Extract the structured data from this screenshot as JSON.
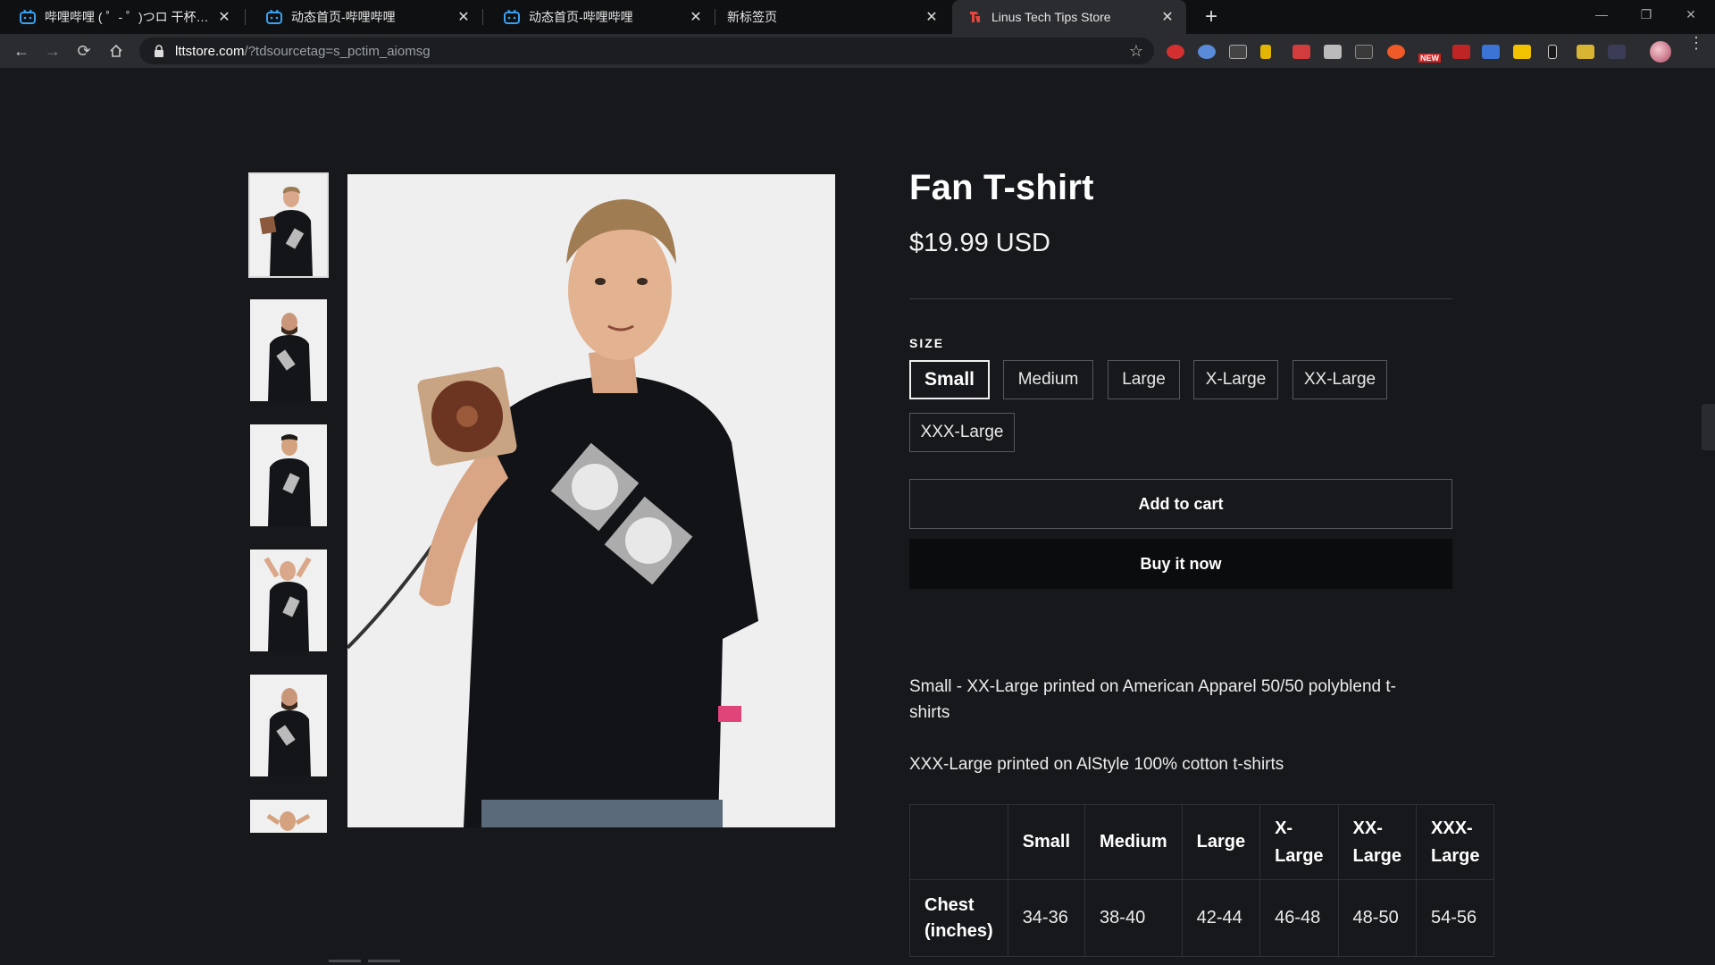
{
  "browser": {
    "tabs": [
      {
        "title": "哔哩哔哩 ( ゜- ゜)つロ 干杯~-bilibili",
        "icon": "bilibili-icon"
      },
      {
        "title": "动态首页-哔哩哔哩",
        "icon": "bilibili-icon"
      },
      {
        "title": "动态首页-哔哩哔哩",
        "icon": "bilibili-icon"
      },
      {
        "title": "新标签页",
        "icon": ""
      },
      {
        "title": "Linus Tech Tips Store",
        "icon": "ltt-icon"
      }
    ],
    "url_host": "lttstore.com",
    "url_path": "/?tdsourcetag=s_pctim_aiomsg",
    "new_badge": "NEW"
  },
  "product": {
    "title": "Fan T-shirt",
    "price": "$19.99 USD",
    "size_label": "SIZE",
    "sizes": [
      "Small",
      "Medium",
      "Large",
      "X-Large",
      "XX-Large",
      "XXX-Large"
    ],
    "selected_size": "Small",
    "add_to_cart": "Add to cart",
    "buy_now": "Buy it now",
    "description": [
      "Small - XX-Large printed on American Apparel 50/50 polyblend t-shirts",
      "XXX-Large printed on AlStyle 100% cotton t-shirts"
    ],
    "size_table": {
      "headers": [
        "",
        "Small",
        "Medium",
        "Large",
        "X-Large",
        "XX-Large",
        "XXX-Large"
      ],
      "rows": [
        {
          "label": "Chest (inches)",
          "values": [
            "34-36",
            "38-40",
            "42-44",
            "46-48",
            "48-50",
            "54-56"
          ]
        }
      ]
    }
  },
  "colors": {
    "page_bg": "#17181b",
    "button_dark": "#0b0c0e",
    "text": "#ffffff"
  }
}
